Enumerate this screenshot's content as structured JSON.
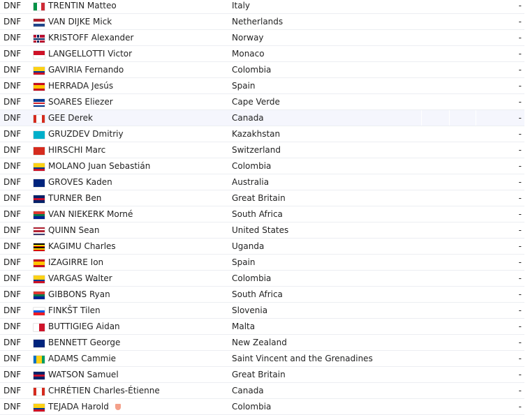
{
  "rows": [
    {
      "result": "DNF",
      "flag": "it",
      "rider": "TRENTIN Matteo",
      "country": "Italy",
      "value": "-"
    },
    {
      "result": "DNF",
      "flag": "nl",
      "rider": "VAN DIJKE Mick",
      "country": "Netherlands",
      "value": "-"
    },
    {
      "result": "DNF",
      "flag": "no",
      "rider": "KRISTOFF Alexander",
      "country": "Norway",
      "value": "-"
    },
    {
      "result": "DNF",
      "flag": "mc",
      "rider": "LANGELLOTTI Victor",
      "country": "Monaco",
      "value": "-"
    },
    {
      "result": "DNF",
      "flag": "co",
      "rider": "GAVIRIA Fernando",
      "country": "Colombia",
      "value": "-"
    },
    {
      "result": "DNF",
      "flag": "es",
      "rider": "HERRADA Jesús",
      "country": "Spain",
      "value": "-"
    },
    {
      "result": "DNF",
      "flag": "cv",
      "rider": "SOARES Eliezer",
      "country": "Cape Verde",
      "value": "-"
    },
    {
      "result": "DNF",
      "flag": "ca",
      "rider": "GEE Derek",
      "country": "Canada",
      "value": "-",
      "hover": true
    },
    {
      "result": "DNF",
      "flag": "kz",
      "rider": "GRUZDEV Dmitriy",
      "country": "Kazakhstan",
      "value": "-"
    },
    {
      "result": "DNF",
      "flag": "ch",
      "rider": "HIRSCHI Marc",
      "country": "Switzerland",
      "value": "-"
    },
    {
      "result": "DNF",
      "flag": "co",
      "rider": "MOLANO Juan Sebastián",
      "country": "Colombia",
      "value": "-"
    },
    {
      "result": "DNF",
      "flag": "au",
      "rider": "GROVES Kaden",
      "country": "Australia",
      "value": "-"
    },
    {
      "result": "DNF",
      "flag": "gb",
      "rider": "TURNER Ben",
      "country": "Great Britain",
      "value": "-"
    },
    {
      "result": "DNF",
      "flag": "za",
      "rider": "VAN NIEKERK Morné",
      "country": "South Africa",
      "value": "-"
    },
    {
      "result": "DNF",
      "flag": "us",
      "rider": "QUINN Sean",
      "country": "United States",
      "value": "-"
    },
    {
      "result": "DNF",
      "flag": "ug",
      "rider": "KAGIMU Charles",
      "country": "Uganda",
      "value": "-"
    },
    {
      "result": "DNF",
      "flag": "es",
      "rider": "IZAGIRRE Ion",
      "country": "Spain",
      "value": "-"
    },
    {
      "result": "DNF",
      "flag": "co",
      "rider": "VARGAS Walter",
      "country": "Colombia",
      "value": "-"
    },
    {
      "result": "DNF",
      "flag": "za",
      "rider": "GIBBONS Ryan",
      "country": "South Africa",
      "value": "-"
    },
    {
      "result": "DNF",
      "flag": "si",
      "rider": "FINKŠT Tilen",
      "country": "Slovenia",
      "value": "-"
    },
    {
      "result": "DNF",
      "flag": "mt",
      "rider": "BUTTIGIEG Aidan",
      "country": "Malta",
      "value": "-"
    },
    {
      "result": "DNF",
      "flag": "nz",
      "rider": "BENNETT George",
      "country": "New Zealand",
      "value": "-"
    },
    {
      "result": "DNF",
      "flag": "vc",
      "rider": "ADAMS Cammie",
      "country": "Saint Vincent and the Grenadines",
      "value": "-"
    },
    {
      "result": "DNF",
      "flag": "gb",
      "rider": "WATSON Samuel",
      "country": "Great Britain",
      "value": "-"
    },
    {
      "result": "DNF",
      "flag": "ca",
      "rider": "CHRÉTIEN Charles-Étienne",
      "country": "Canada",
      "value": "-"
    },
    {
      "result": "DNF",
      "flag": "co",
      "rider": "TEJADA Harold",
      "country": "Colombia",
      "value": "-",
      "badge": "shield-icon"
    }
  ],
  "colors": {
    "hover_row": "#f5f6fd",
    "divider": "#eceef2",
    "badge": "#f4a08a"
  }
}
